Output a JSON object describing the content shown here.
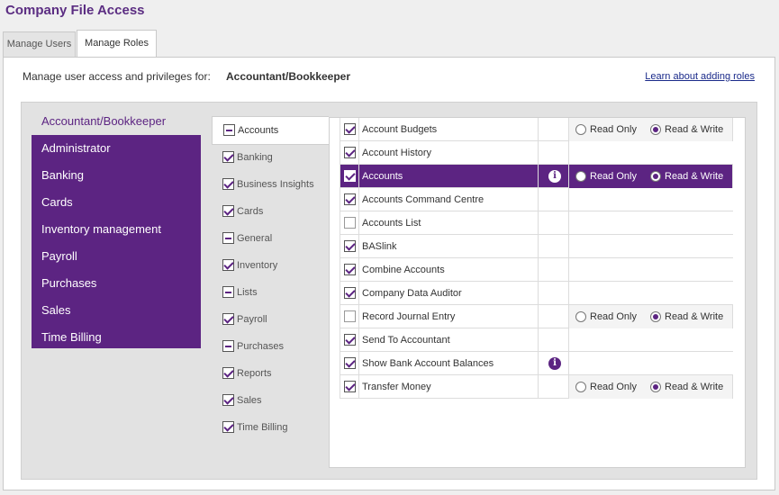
{
  "page_title": "Company File Access",
  "tabs": [
    {
      "label": "Manage Users",
      "active": false
    },
    {
      "label": "Manage Roles",
      "active": true
    }
  ],
  "header": {
    "manage_label": "Manage user access and privileges for:",
    "current_role": "Accountant/Bookkeeper",
    "learn_link": "Learn about adding roles"
  },
  "roles": [
    {
      "label": "Accountant/Bookkeeper",
      "selected": true
    },
    {
      "label": "Administrator",
      "selected": false
    },
    {
      "label": "Banking",
      "selected": false
    },
    {
      "label": "Cards",
      "selected": false
    },
    {
      "label": "Inventory management",
      "selected": false
    },
    {
      "label": "Payroll",
      "selected": false
    },
    {
      "label": "Purchases",
      "selected": false
    },
    {
      "label": "Sales",
      "selected": false
    },
    {
      "label": "Time Billing",
      "selected": false
    }
  ],
  "categories": [
    {
      "label": "Accounts",
      "state": "partial",
      "selected": true
    },
    {
      "label": "Banking",
      "state": "checked",
      "selected": false
    },
    {
      "label": "Business Insights",
      "state": "checked",
      "selected": false
    },
    {
      "label": "Cards",
      "state": "checked",
      "selected": false
    },
    {
      "label": "General",
      "state": "partial",
      "selected": false
    },
    {
      "label": "Inventory",
      "state": "checked",
      "selected": false
    },
    {
      "label": "Lists",
      "state": "partial",
      "selected": false
    },
    {
      "label": "Payroll",
      "state": "checked",
      "selected": false
    },
    {
      "label": "Purchases",
      "state": "partial",
      "selected": false
    },
    {
      "label": "Reports",
      "state": "checked",
      "selected": false
    },
    {
      "label": "Sales",
      "state": "checked",
      "selected": false
    },
    {
      "label": "Time Billing",
      "state": "checked",
      "selected": false
    }
  ],
  "access_labels": {
    "read_only": "Read Only",
    "read_write": "Read & Write"
  },
  "permissions": [
    {
      "name": "Account Budgets",
      "checked": true,
      "info": false,
      "access": "read_write",
      "selected": false
    },
    {
      "name": "Account History",
      "checked": true,
      "info": false,
      "access": null,
      "selected": false
    },
    {
      "name": "Accounts",
      "checked": true,
      "info": true,
      "access": "read_write",
      "selected": true
    },
    {
      "name": "Accounts Command Centre",
      "checked": true,
      "info": false,
      "access": null,
      "selected": false
    },
    {
      "name": "Accounts List",
      "checked": false,
      "info": false,
      "access": null,
      "selected": false
    },
    {
      "name": "BASlink",
      "checked": true,
      "info": false,
      "access": null,
      "selected": false
    },
    {
      "name": "Combine Accounts",
      "checked": true,
      "info": false,
      "access": null,
      "selected": false
    },
    {
      "name": "Company Data Auditor",
      "checked": true,
      "info": false,
      "access": null,
      "selected": false
    },
    {
      "name": "Record Journal Entry",
      "checked": false,
      "info": false,
      "access": "read_write",
      "selected": false
    },
    {
      "name": "Send To Accountant",
      "checked": true,
      "info": false,
      "access": null,
      "selected": false
    },
    {
      "name": "Show Bank Account Balances",
      "checked": true,
      "info": true,
      "access": null,
      "selected": false
    },
    {
      "name": "Transfer Money",
      "checked": true,
      "info": false,
      "access": "read_write",
      "selected": false
    }
  ],
  "icons": {
    "info": "info-icon",
    "check": "check-icon",
    "partial": "minus-icon"
  },
  "colors": {
    "brand": "#5c2482",
    "link": "#1a2a8a"
  }
}
